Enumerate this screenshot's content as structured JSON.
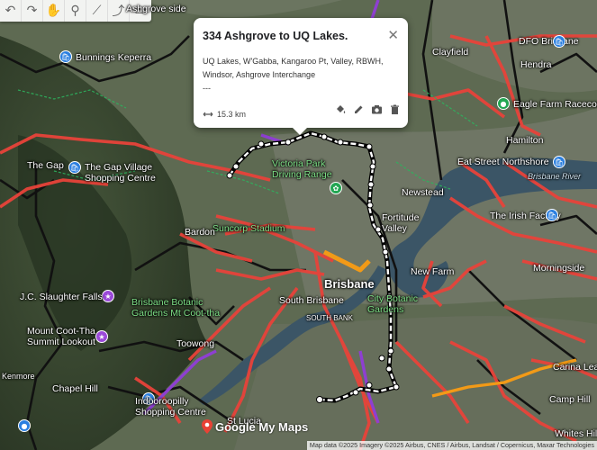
{
  "toolbar": {
    "tools": [
      {
        "name": "undo-button",
        "icon": "undo-icon",
        "glyph": "↶"
      },
      {
        "name": "redo-button",
        "icon": "redo-icon",
        "glyph": "↷"
      },
      {
        "name": "pan-button",
        "icon": "hand-icon",
        "glyph": "✋"
      },
      {
        "name": "add-marker-button",
        "icon": "marker-icon",
        "glyph": "⚲"
      },
      {
        "name": "draw-line-button",
        "icon": "line-icon",
        "glyph": "⟋"
      },
      {
        "name": "add-directions-button",
        "icon": "directions-icon",
        "glyph": "⤴"
      },
      {
        "name": "measure-button",
        "icon": "ruler-icon",
        "glyph": "▭"
      }
    ]
  },
  "popup": {
    "title": "334 Ashgrove to UQ Lakes.",
    "description_lines": [
      "UQ Lakes, W'Gabba, Kangaroo Pt, Valley, RBWH,",
      "Windsor, Ashgrove Interchange",
      "---"
    ],
    "distance": "15.3 km",
    "close_glyph": "✕"
  },
  "places": {
    "ashgrove_side": "Ashgrove side",
    "bunnings": "Bunnings Keperra",
    "the_gap_village": "The Gap Village\nShopping Centre",
    "the_gap": "The Gap",
    "jc_slaughter": "J.C. Slaughter Falls",
    "mount_cootha_lookout": "Mount Coot-Tha\nSummit Lookout",
    "botanic_gardens": "Brisbane Botanic\nGardens Mt Coot-tha",
    "victoria_park": "Victoria Park\nDriving Range",
    "suncorp": "Suncorp Stadium",
    "bardon": "Bardon",
    "newstead": "Newstead",
    "fortitude_valley": "Fortitude\nValley",
    "new_farm": "New Farm",
    "brisbane": "Brisbane",
    "south_brisbane": "South Brisbane",
    "south_bank": "SOUTH BANK",
    "city_botanic": "City Botanic\nGardens",
    "chapel_hill": "Chapel Hill",
    "indooroopilly": "Indooroopilly\nShopping Centre",
    "st_lucia": "St Lucia",
    "toowong": "Toowong",
    "hendra": "Hendra",
    "dfo": "DFO Brisbane",
    "eagle_farm": "Eagle Farm Racecourse",
    "hamilton": "Hamilton",
    "eat_street": "Eat Street Northshore",
    "brisbane_river": "Brisbane River",
    "irish_factory": "The Irish Factory",
    "morningside": "Morningside",
    "carina_league": "Carina League",
    "camp_hill": "Camp Hill",
    "whites_hill": "Whites Hill",
    "clayfield": "Clayfield",
    "kenmore": "Kenmore"
  },
  "logo_text": "Google My Maps",
  "attribution": "Map data ©2025 Imagery ©2025 Airbus, CNES / Airbus, Landsat / Copernicus, Maxar Technologies",
  "colors": {
    "route_red": "#e8433a",
    "route_black": "#111111",
    "route_purple": "#8e3fd1",
    "route_orange": "#f29a17",
    "selected_route": "#ffffff",
    "popup_bg": "#ffffff"
  }
}
